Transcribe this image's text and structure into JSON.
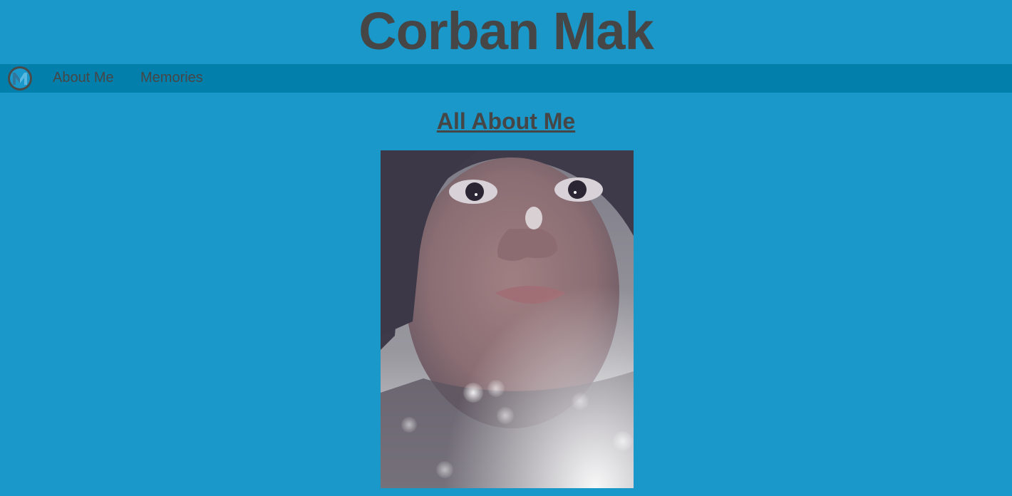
{
  "header": {
    "title": "Corban Mak"
  },
  "nav": {
    "logo_icon": "m-logo-icon",
    "items": [
      {
        "label": "About Me"
      },
      {
        "label": "Memories"
      }
    ]
  },
  "main": {
    "heading": "All About Me",
    "photo": {
      "kind": "photograph",
      "subject": "portrait-photo"
    }
  },
  "colors": {
    "page_background": "#1a98c9",
    "nav_background": "#0280ab",
    "text": "#464646"
  }
}
